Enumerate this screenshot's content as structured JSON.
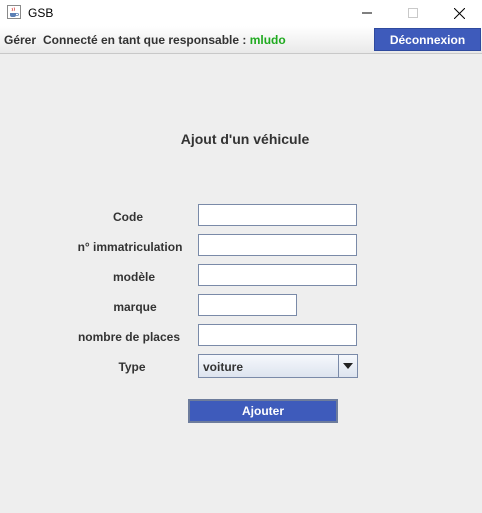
{
  "window": {
    "title": "GSB",
    "icon": "java-cup-icon"
  },
  "menubar": {
    "menu_gerer": "Gérer",
    "status_prefix": "Connecté en tant que responsable :",
    "username": "mludo",
    "logout_label": "Déconnexion"
  },
  "form": {
    "title": "Ajout d'un véhicule",
    "fields": {
      "code": {
        "label": "Code",
        "value": ""
      },
      "immatriculation": {
        "label": "n° immatriculation",
        "value": ""
      },
      "modele": {
        "label": "modèle",
        "value": ""
      },
      "marque": {
        "label": "marque",
        "value": ""
      },
      "places": {
        "label": "nombre de places",
        "value": ""
      },
      "type": {
        "label": "Type",
        "value": "voiture"
      }
    },
    "submit_label": "Ajouter"
  },
  "colors": {
    "accent": "#3e5bbb",
    "username": "#1faa1f"
  }
}
